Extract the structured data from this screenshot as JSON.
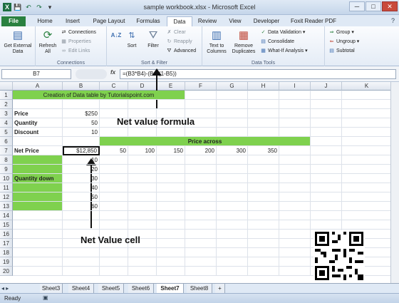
{
  "window": {
    "title": "sample workbook.xlsx - Microsoft Excel",
    "buttons": [
      "─",
      "□",
      "✕"
    ]
  },
  "quick_access": [
    "X",
    "💾",
    "↶",
    "↷",
    "▾"
  ],
  "ribbon_tabs": [
    "File",
    "Home",
    "Insert",
    "Page Layout",
    "Formulas",
    "Data",
    "Review",
    "View",
    "Developer",
    "Foxit Reader PDF"
  ],
  "active_tab": "Data",
  "ribbon": {
    "get_external": "Get External Data",
    "refresh_all": "Refresh All",
    "connections": "Connections",
    "properties": "Properties",
    "edit_links": "Edit Links",
    "connections_group": "Connections",
    "sort_az": "A↓Z",
    "sort": "Sort",
    "filter": "Filter",
    "clear": "Clear",
    "reapply": "Reapply",
    "advanced": "Advanced",
    "sort_filter_group": "Sort & Filter",
    "text_to_columns": "Text to Columns",
    "remove_duplicates": "Remove Duplicates",
    "data_validation": "Data Validation",
    "consolidate": "Consolidate",
    "what_if": "What-If Analysis",
    "data_tools_group": "Data Tools",
    "group": "Group",
    "ungroup": "Ungroup",
    "subtotal": "Subtotal"
  },
  "formula_bar": {
    "name_box": "B7",
    "fx": "fx",
    "formula": "=(B3*B4)-(B4*(1-B5))"
  },
  "columns": [
    "A",
    "B",
    "C",
    "D",
    "E",
    "F",
    "G",
    "H",
    "I",
    "J",
    "K"
  ],
  "rows": [
    "1",
    "2",
    "3",
    "4",
    "5",
    "6",
    "7",
    "8",
    "9",
    "10",
    "11",
    "12",
    "13",
    "14",
    "15",
    "16",
    "17",
    "18",
    "19",
    "20"
  ],
  "cells": {
    "title": "Creation of Data table by Tutorialspoint.com",
    "price_label": "Price",
    "price_value": "$250",
    "quantity_label": "Quantity",
    "quantity_value": "50",
    "discount_label": "Discount",
    "discount_value": "10",
    "price_across": "Price across",
    "net_price_label": "Net Price",
    "net_price_value": "$12,850",
    "price_across_values": [
      "50",
      "100",
      "150",
      "200",
      "300",
      "350"
    ],
    "quantity_down": "Quantity down",
    "quantity_down_values": [
      "10",
      "20",
      "30",
      "40",
      "50",
      "60"
    ]
  },
  "annotations": {
    "formula": "Net value formula",
    "cell": "Net Value cell"
  },
  "sheet_tabs": [
    "Sheet3",
    "Sheet4",
    "Sheet5",
    "Sheet6",
    "Sheet7",
    "Sheet8"
  ],
  "active_sheet": "Sheet7",
  "status": "Ready"
}
